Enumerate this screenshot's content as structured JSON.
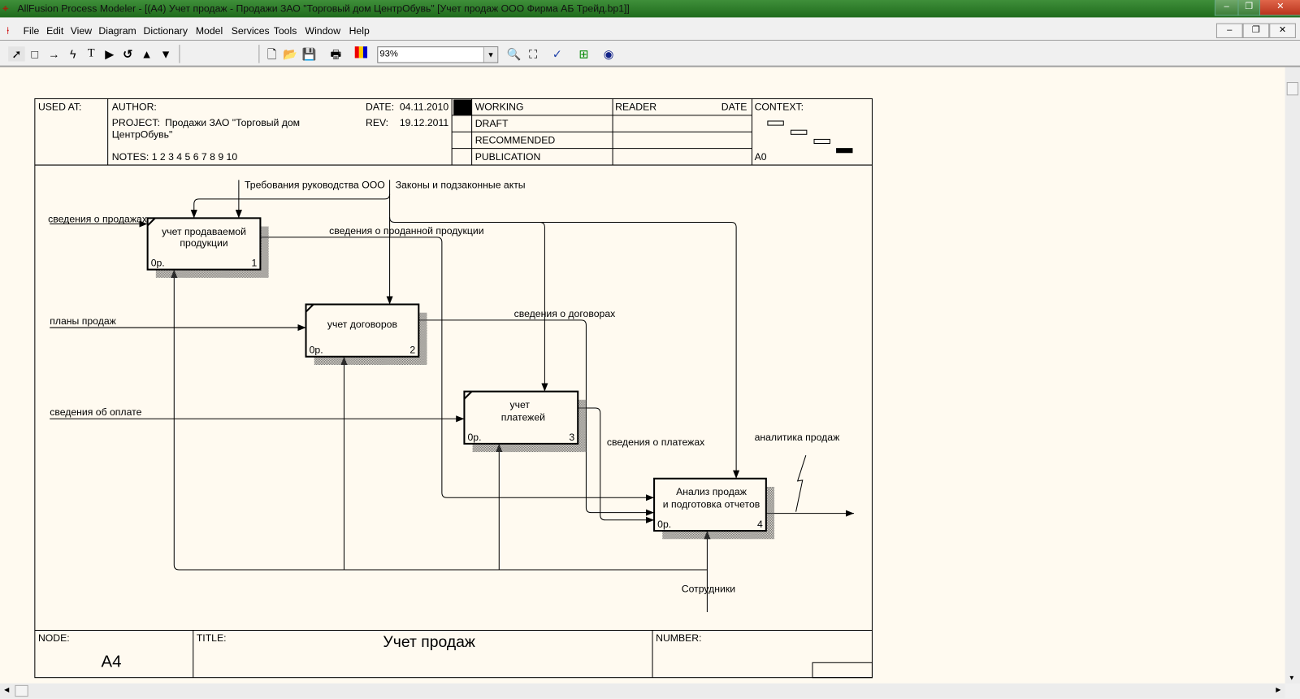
{
  "window": {
    "title": "AllFusion Process Modeler - [(A4) Учет продаж  - Продажи ЗАО \"Торговый дом ЦентрОбувь\"  [Учет продаж ООО Фирма АБ Трейд.bp1]]",
    "buttons": {
      "minimize": "–",
      "restore": "❐",
      "close": "✕"
    }
  },
  "menu": [
    "File",
    "Edit",
    "View",
    "Diagram",
    "Dictionary",
    "Model",
    "Services",
    "Tools",
    "Window",
    "Help"
  ],
  "toolbar": {
    "zoom_value": "93%",
    "tools": [
      "pointer-tool",
      "box-tool",
      "arrow-tool",
      "squiggle-tool",
      "text-tool",
      "triangle-right-tool",
      "undo-tool",
      "go-up-tool",
      "go-down-tool"
    ],
    "file_tools": [
      "new",
      "open",
      "save",
      "print",
      "color",
      "zoom-in",
      "zoom-fit",
      "spell-check",
      "model-explorer",
      "web"
    ]
  },
  "header": {
    "used_at": "USED AT:",
    "author": "AUTHOR:",
    "project_label": "PROJECT:",
    "project_line1": "Продажи ЗАО \"Торговый дом",
    "project_line2": "ЦентрОбувь\"",
    "notes": "NOTES:  1  2  3  4  5  6  7  8  9  10",
    "date_label": "DATE:",
    "date": "04.11.2010",
    "rev_label": "REV:",
    "rev": "19.12.2011",
    "statuses": [
      "WORKING",
      "DRAFT",
      "RECOMMENDED",
      "PUBLICATION"
    ],
    "reader": "READER",
    "reader_date": "DATE",
    "context": "CONTEXT:",
    "context_node": "A0"
  },
  "boxes": [
    {
      "line1": "учет продаваемой",
      "line2": "продукции",
      "cost": "0р.",
      "number": "1"
    },
    {
      "line1": "учет договоров",
      "line2": "",
      "cost": "0р.",
      "number": "2"
    },
    {
      "line1": "учет",
      "line2": "платежей",
      "cost": "0р.",
      "number": "3"
    },
    {
      "line1": "Анализ продаж",
      "line2": "и подготовка отчетов",
      "cost": "0р.",
      "number": "4"
    }
  ],
  "arrows": {
    "sales_info": "сведения о продажах",
    "sales_plans": "планы продаж",
    "payment_info": "сведения об оплате",
    "management_reqs": "Требования руководства ООО",
    "laws": "Законы и подзаконные акты",
    "sold_products": "сведения о проданной продукции",
    "contracts": "сведения о договорах",
    "payments": "сведения о платежах",
    "analytics": "аналитика продаж",
    "staff": "Сотрудники"
  },
  "footer": {
    "node_label": "NODE:",
    "node": "A4",
    "title_label": "TITLE:",
    "title": "Учет продаж",
    "number_label": "NUMBER:"
  }
}
